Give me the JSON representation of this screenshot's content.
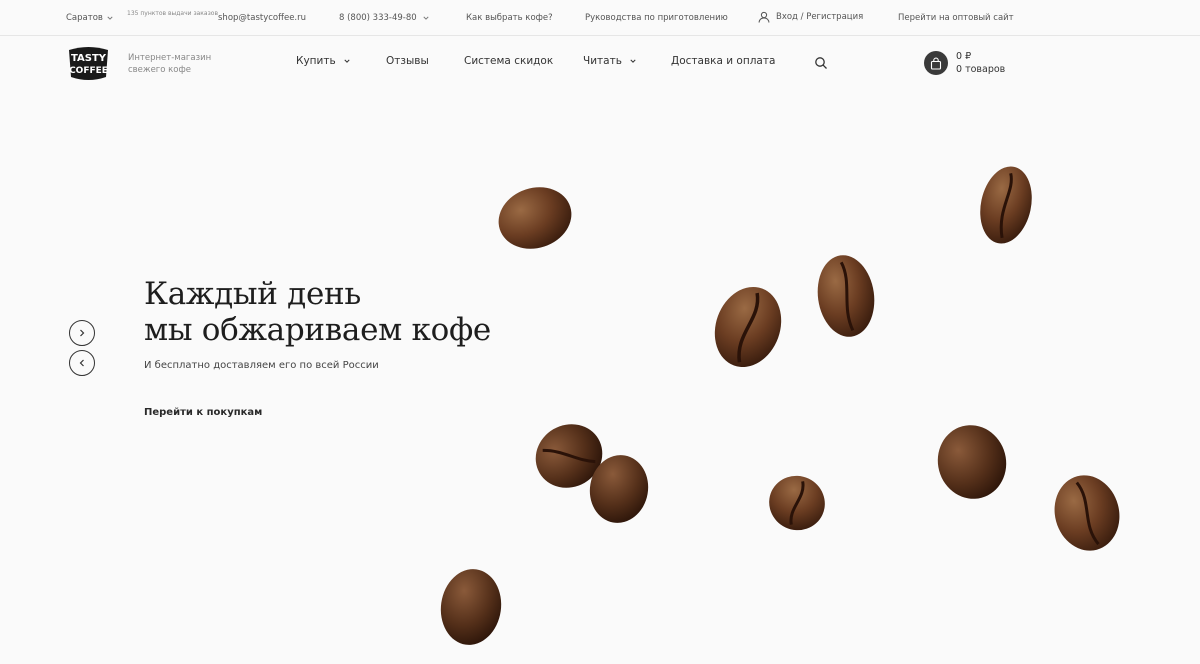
{
  "topbar": {
    "city": "Саратов",
    "pickup_points": "135 пунктов выдачи заказов",
    "email": "shop@tastycoffee.ru",
    "phone": "8 (800) 333-49-80",
    "how_to_choose": "Как выбрать кофе?",
    "brew_guides": "Руководства по приготовлению",
    "login": "Вход / Регистрация",
    "wholesale": "Перейти на оптовый сайт"
  },
  "header": {
    "logo_text": "TASTY COFFEE",
    "tagline": "Интернет-магазин свежего кофе",
    "nav": {
      "buy": "Купить",
      "reviews": "Отзывы",
      "discounts": "Система скидок",
      "read": "Читать",
      "delivery": "Доставка и оплата"
    },
    "cart": {
      "total": "0 ₽",
      "count": "0 товаров"
    }
  },
  "hero": {
    "title_line1": "Каждый день",
    "title_line2": "мы обжариваем кофе",
    "subtitle": "И бесплатно доставляем его по всей России",
    "cta": "Перейти к покупкам"
  },
  "icons": {
    "city_chevron": "chevron-down-icon",
    "phone_chevron": "chevron-down-icon",
    "user": "user-icon",
    "search": "search-icon",
    "cart": "shopping-bag-icon",
    "slider_next": "chevron-right-icon",
    "slider_prev": "chevron-left-icon"
  },
  "colors": {
    "background": "#fafafa",
    "text_dark": "#1e1e1e",
    "bean_dark": "#4a2a18",
    "bean_mid": "#7a4a2c",
    "cart_circle": "#3a3a3a"
  }
}
